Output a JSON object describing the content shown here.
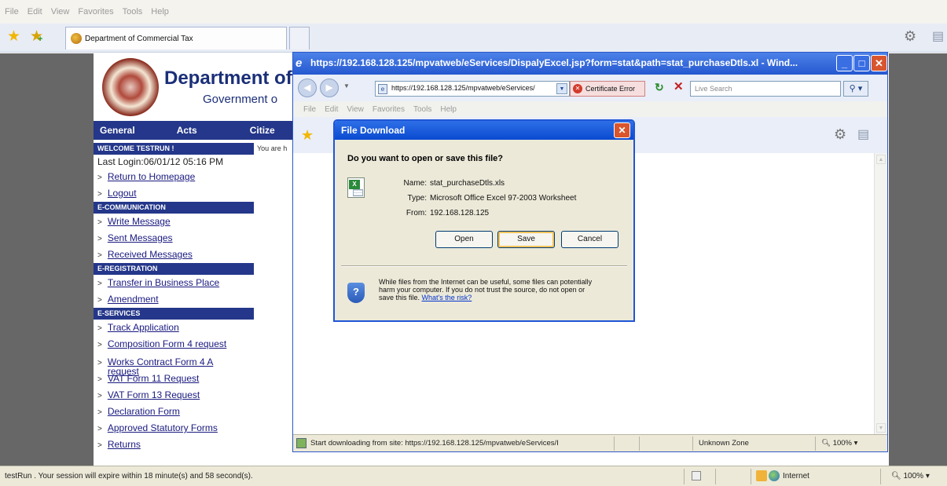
{
  "browser": {
    "menu": [
      "File",
      "Edit",
      "View",
      "Favorites",
      "Tools",
      "Help"
    ],
    "tab_title": "Department of Commercial Tax",
    "status_text": "testRun . Your session will expire within 18 minute(s) and 58 second(s).",
    "zone": "Internet",
    "zoom": "100%"
  },
  "site": {
    "title": "Department of",
    "subtitle": "Government o",
    "nav": [
      "General",
      "Acts",
      "Citize"
    ],
    "main_text": "You are h"
  },
  "sidebar": {
    "welcome": "WELCOME TESTRUN !",
    "last_login": "Last Login:06/01/12 05:16 PM",
    "top_links": [
      "Return to Homepage",
      "Logout"
    ],
    "e_communication": {
      "header": "E-COMMUNICATION",
      "items": [
        "Write Message",
        "Sent Messages",
        "Received Messages"
      ]
    },
    "e_registration": {
      "header": "E-REGISTRATION",
      "items": [
        "Transfer in Business Place",
        "Amendment"
      ]
    },
    "e_services": {
      "header": "E-SERVICES",
      "items": [
        "Track Application",
        "Composition Form 4 request",
        "Works Contract Form 4 A request",
        "VAT Form 11 Request",
        "VAT Form 13 Request",
        "Declaration Form",
        "Approved Statutory Forms",
        "Returns"
      ]
    }
  },
  "popup": {
    "title": "https://192.168.128.125/mpvatweb/eServices/DispalyExcel.jsp?form=stat&path=stat_purchaseDtls.xl - Wind...",
    "address": "https://192.168.128.125/mpvatweb/eServices/",
    "cert_error": "Certificate Error",
    "search_placeholder": "Live Search",
    "menu": [
      "File",
      "Edit",
      "View",
      "Favorites",
      "Tools",
      "Help"
    ],
    "status_text": "Start downloading from site: https://192.168.128.125/mpvatweb/eServices/I",
    "zone": "Unknown Zone",
    "zoom": "100%"
  },
  "dialog": {
    "title": "File Download",
    "question": "Do you want to open or save this file?",
    "name_label": "Name:",
    "name_value": "stat_purchaseDtls.xls",
    "type_label": "Type:",
    "type_value": "Microsoft Office Excel 97-2003 Worksheet",
    "from_label": "From:",
    "from_value": "192.168.128.125",
    "open": "Open",
    "save": "Save",
    "cancel": "Cancel",
    "warning_line1": "While files from the Internet can be useful, some files can potentially",
    "warning_line2": "harm your computer. If you do not trust the source, do not open or",
    "warning_line3": "save this file.",
    "risk_link": "What's the risk?"
  },
  "colors": {
    "nav_blue": "#24378a",
    "xp_title_blue": "#0a4ad0",
    "background_gray": "#676767"
  }
}
